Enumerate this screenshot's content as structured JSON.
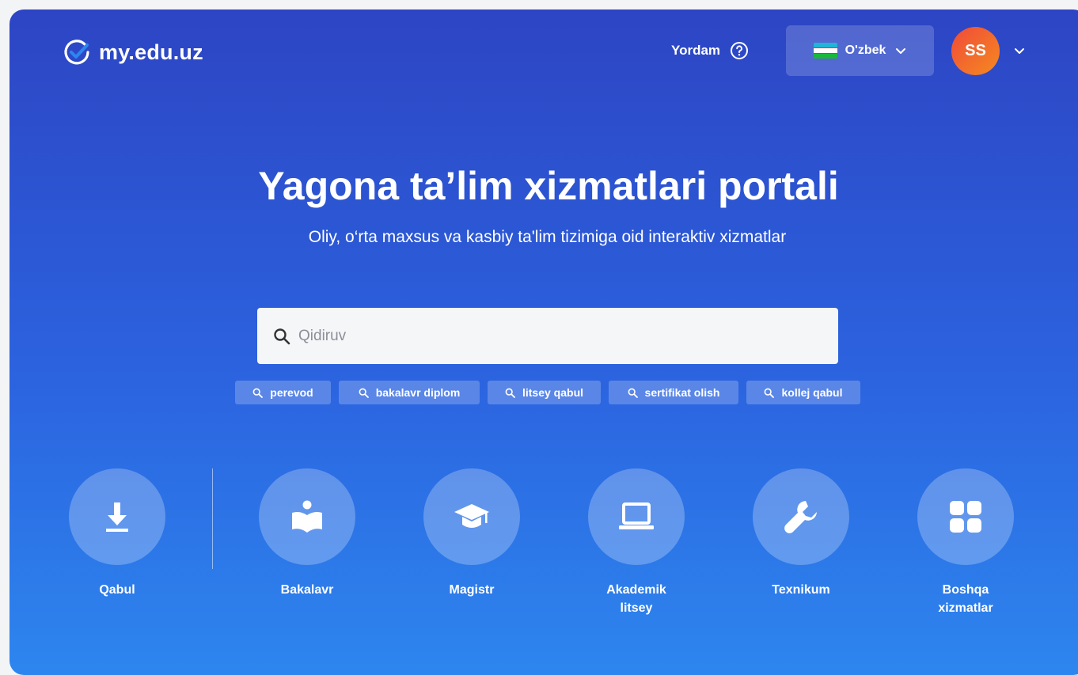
{
  "header": {
    "logo_text": "my.edu.uz",
    "help_label": "Yordam",
    "language": "O'zbek",
    "avatar_initials": "SS"
  },
  "hero": {
    "title": "Yagona ta’lim xizmatlari portali",
    "subtitle": "Oliy, o‘rta maxsus va kasbiy ta'lim tizimiga oid interaktiv xizmatlar"
  },
  "search": {
    "placeholder": "Qidiruv",
    "chips": [
      "perevod",
      "bakalavr diplom",
      "litsey qabul",
      "sertifikat olish",
      "kollej qabul"
    ]
  },
  "categories": [
    {
      "label": "Qabul",
      "icon": "download-icon"
    },
    {
      "label": "Bakalavr",
      "icon": "reading-person-icon"
    },
    {
      "label": "Magistr",
      "icon": "graduation-cap-icon"
    },
    {
      "label": "Akademik litsey",
      "icon": "laptop-icon"
    },
    {
      "label": "Texnikum",
      "icon": "wrench-icon"
    },
    {
      "label": "Boshqa xizmatlar",
      "icon": "grid-icon"
    }
  ],
  "colors": {
    "gradient_top": "#2d45c4",
    "gradient_bottom": "#2d86ef",
    "avatar": "#f04a3a",
    "logo_check": "#2d86ef"
  }
}
